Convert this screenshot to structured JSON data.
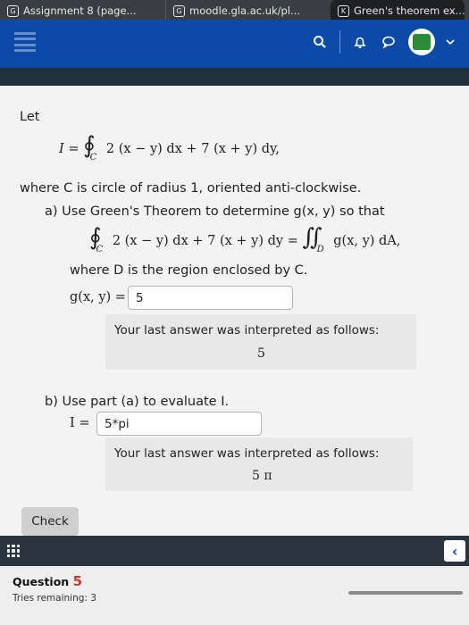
{
  "browser": {
    "tabs": [
      {
        "favicon": "G",
        "label": "Assignment 8 (page..."
      },
      {
        "favicon": "G",
        "label": "moodle.gla.ac.uk/pl..."
      },
      {
        "favicon": "K",
        "label": "Green's theorem ex..."
      }
    ]
  },
  "header": {
    "icons": [
      "search-icon",
      "bell-icon",
      "chat-icon",
      "avatar",
      "chevron-down-icon"
    ]
  },
  "question": {
    "intro": "Let",
    "integral_lhs": "I =",
    "integrand": "2 (x − y) dx + 7 (x + y) dy,",
    "contour_sub": "C",
    "where_text": "where C is circle of radius 1, oriented anti-clockwise.",
    "part_a_text": "a) Use Green's Theorem to determine g(x, y) so that",
    "part_a_equation_left": "2 (x − y) dx + 7 (x + y) dy =",
    "double_integral_sub": "D",
    "part_a_equation_right": "g(x, y) dA,",
    "region_text": "where D is the region enclosed by C.",
    "g_label": "g(x, y) =",
    "g_answer": "5",
    "g_feedback_title": "Your last answer was interpreted as follows:",
    "g_feedback_value": "5",
    "part_b_text": "b) Use part (a) to evaluate I.",
    "i_label": "I =",
    "i_answer": "5*pi",
    "i_feedback_title": "Your last answer was interpreted as follows:",
    "i_feedback_value": "5 π"
  },
  "check_button": "Check",
  "footer": {
    "question_label": "Question",
    "question_number": "5",
    "tries": "Tries remaining: 3"
  },
  "colors": {
    "navbar": "#0b4aa6",
    "question_number": "#c53b2e"
  }
}
